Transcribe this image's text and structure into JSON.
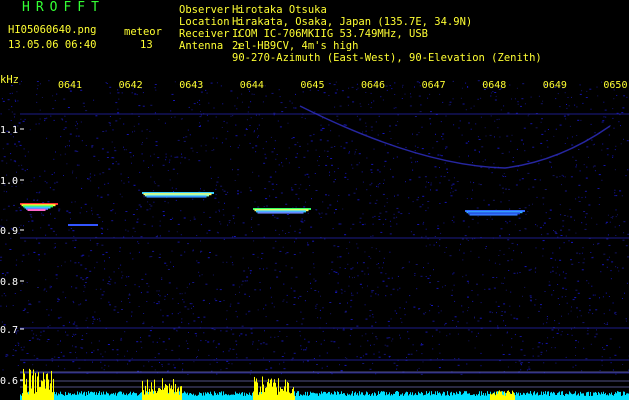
{
  "header": {
    "app_title": "HROFFT",
    "file_name": "HI05060640.png",
    "timestamp": "13.05.06 06:40",
    "meteor_label": "meteor",
    "meteor_count": "13",
    "info_labels": "Observer :\nLocation :\nReceiver :\nAntenna  :",
    "info_values": "Hirotaka Otsuka\nHirakata, Osaka, Japan (135.7E, 34.9N)\nICOM IC-706MKIIG 53.749MHz, USB\n2el-HB9CV, 4m's high\n90-270-Azimuth (East-West), 90-Elevation (Zenith)"
  },
  "axis": {
    "y_unit": "kHz",
    "time_ticks": [
      "0641",
      "0642",
      "0643",
      "0644",
      "0645",
      "0646",
      "0647",
      "0648",
      "0649",
      "0650"
    ],
    "freq_ticks": [
      "1.1",
      "1.0",
      "0.9",
      "0.8",
      "0.7",
      "0.6"
    ]
  },
  "colors": {
    "background": "#000000",
    "title_green": "#33ff33",
    "label_yellow": "#ffff33",
    "noise_blue": "#1a1aa0",
    "signal_cyan": "#33ccff",
    "bar_yellow": "#ffff00",
    "bar_cyan": "#00e0ff"
  }
}
